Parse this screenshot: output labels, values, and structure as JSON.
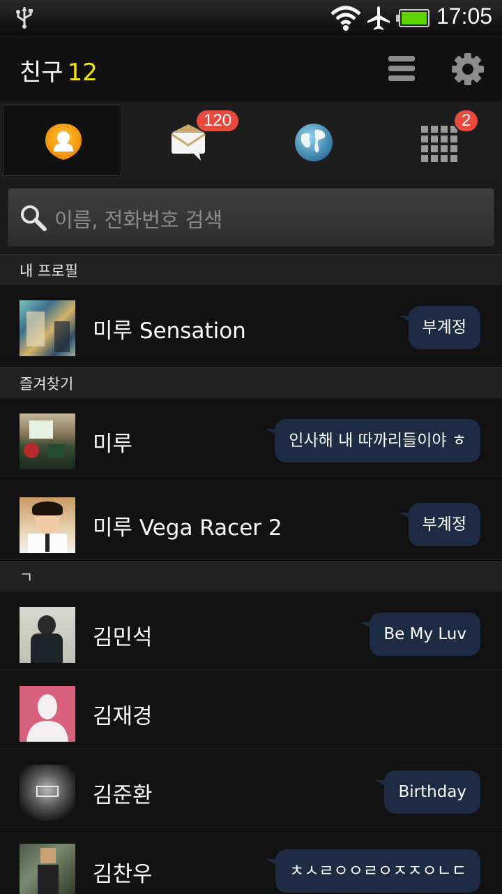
{
  "status_bar": {
    "time": "17:05",
    "icons": [
      "usb-icon",
      "wifi-icon",
      "airplane-icon",
      "battery-icon"
    ],
    "battery_color": "#5fd300"
  },
  "header": {
    "title": "친구",
    "count": "12",
    "count_color": "#f5e414",
    "actions": [
      "menu-icon",
      "gear-icon"
    ]
  },
  "tabs": [
    {
      "name": "friends",
      "icon": "person-icon",
      "active": true
    },
    {
      "name": "chats",
      "icon": "speech-envelope-icon",
      "badge": "120"
    },
    {
      "name": "discover",
      "icon": "globe-icon"
    },
    {
      "name": "more",
      "icon": "grid-icon",
      "badge": "2"
    }
  ],
  "search": {
    "placeholder": "이름, 전화번호 검색"
  },
  "sections": {
    "my_profile": "내 프로필",
    "favorites": "즐겨찾기",
    "giyeok": "ㄱ"
  },
  "rows": [
    {
      "name": "미루 Sensation",
      "status": "부계정"
    },
    {
      "name": "미루",
      "status": "인사해 내 따까리들이야 ㅎ"
    },
    {
      "name": "미루 Vega Racer 2",
      "status": "부계정"
    },
    {
      "name": "김민석",
      "status": "Be My Luv"
    },
    {
      "name": "김재경",
      "status": ""
    },
    {
      "name": "김준환",
      "status": "Birthday"
    },
    {
      "name": "김찬우",
      "status": "ㅊㅅㄹㅇㅇㄹㅇㅈㅈㅇㄴㄷ"
    }
  ]
}
